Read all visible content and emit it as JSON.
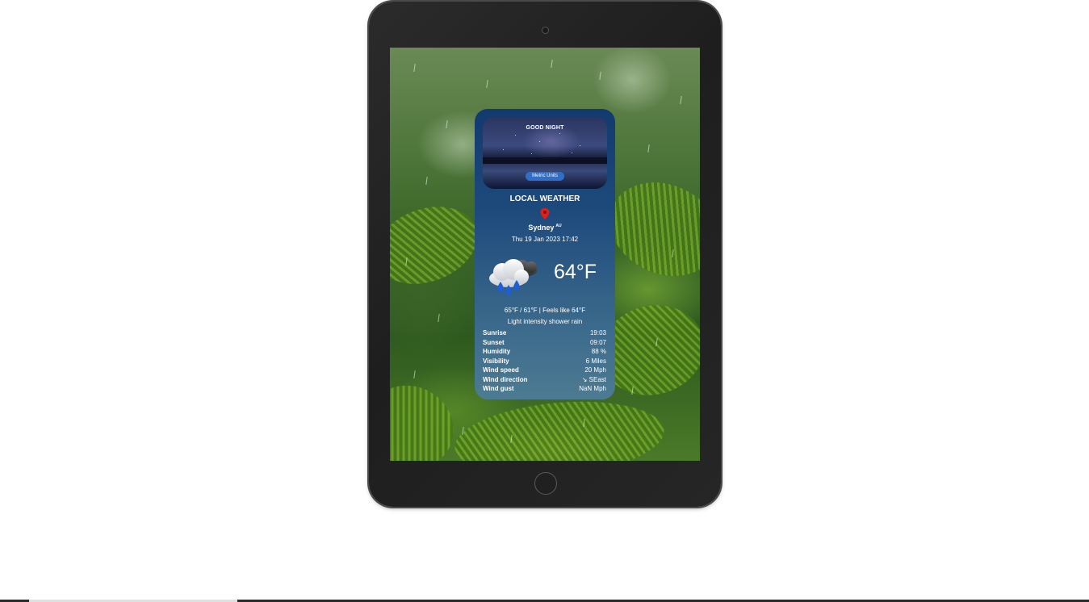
{
  "widget": {
    "greeting": "GOOD NIGHT",
    "units_button": "Metric Units",
    "title": "LOCAL WEATHER",
    "city": "Sydney",
    "country": "AU",
    "datetime": "Thu 19 Jan 2023 17:42",
    "temperature": "64°F",
    "minmax": "65°F  /  61°F  | Feels like 64°F",
    "description": "Light intensity shower rain",
    "details": [
      {
        "label": "Sunrise",
        "value": "19:03"
      },
      {
        "label": "Sunset",
        "value": "09:07"
      },
      {
        "label": "Humidity",
        "value": "88 %"
      },
      {
        "label": "Visibility",
        "value": "6 Miles"
      },
      {
        "label": "Wind speed",
        "value": "20 Mph"
      },
      {
        "label": "Wind direction",
        "value": "↘ SEast"
      },
      {
        "label": "Wind gust",
        "value": "NaN Mph"
      }
    ],
    "icons": {
      "location": "map-pin-icon",
      "weather": "rain-cloud-icon"
    },
    "colors": {
      "card_top": "#133a6e",
      "card_bottom": "#4d7b92",
      "button": "#2f6fc7",
      "pin": "#e0201a"
    }
  }
}
